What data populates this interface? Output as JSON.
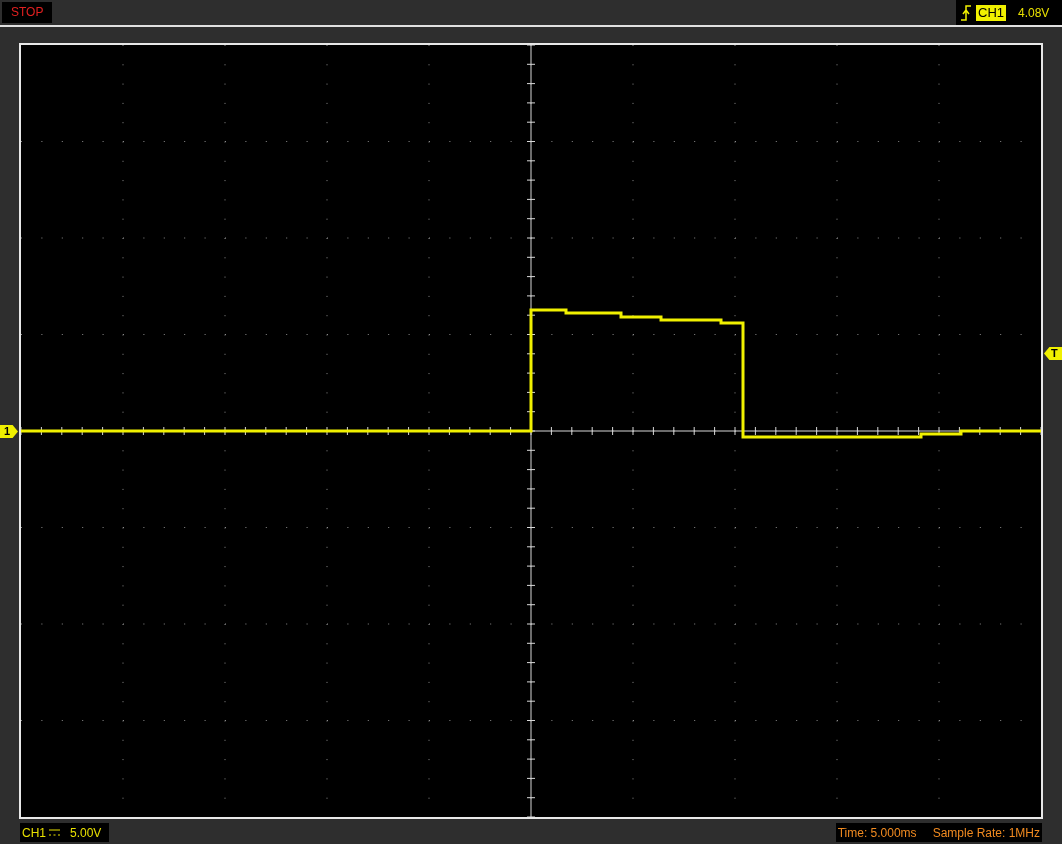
{
  "top_bar": {
    "run_state": "STOP",
    "trigger": {
      "channel": "CH1",
      "level": "4.08V"
    }
  },
  "screen": {
    "channel_marker": "1",
    "trigger_marker": "T"
  },
  "status_bar": {
    "channel": "CH1",
    "volts_per_div": "5.00V",
    "time": "Time: 5.000ms",
    "sample_rate": "Sample Rate: 1MHz"
  }
}
